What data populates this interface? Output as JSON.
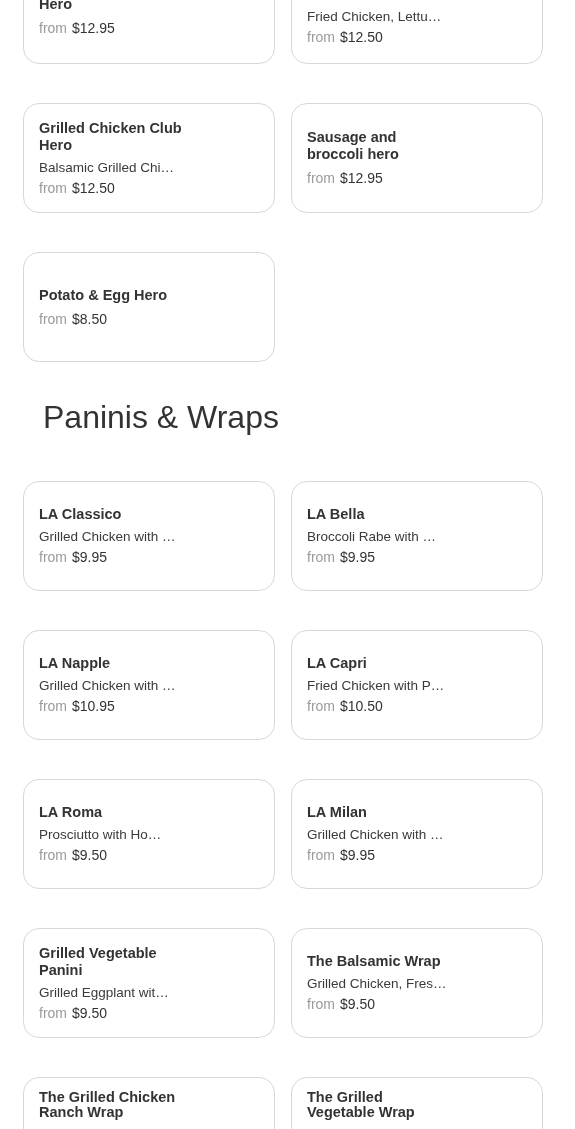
{
  "sections": [
    {
      "items": [
        {
          "name": "Hero",
          "price_prefix": "from",
          "price": "$12.95"
        },
        {
          "description": "Fried Chicken, Lettu…",
          "price_prefix": "from",
          "price": "$12.50"
        },
        {
          "name": "Grilled Chicken Club Hero",
          "description": "Balsamic Grilled Chi…",
          "price_prefix": "from",
          "price": "$12.50"
        },
        {
          "name": "Sausage and broccoli hero",
          "price_prefix": "from",
          "price": "$12.95"
        },
        {
          "name": "Potato & Egg Hero",
          "price_prefix": "from",
          "price": "$8.50"
        }
      ]
    },
    {
      "title": "Paninis & Wraps",
      "items": [
        {
          "name": "LA Classico",
          "description": "Grilled Chicken with …",
          "price_prefix": "from",
          "price": "$9.95"
        },
        {
          "name": "LA Bella",
          "description": "Broccoli Rabe with …",
          "price_prefix": "from",
          "price": "$9.95"
        },
        {
          "name": "LA Napple",
          "description": "Grilled Chicken with …",
          "price_prefix": "from",
          "price": "$10.95"
        },
        {
          "name": "LA Capri",
          "description": "Fried Chicken with P…",
          "price_prefix": "from",
          "price": "$10.50"
        },
        {
          "name": "LA Roma",
          "description": "Prosciutto with Ho…",
          "price_prefix": "from",
          "price": "$9.50"
        },
        {
          "name": "LA Milan",
          "description": "Grilled Chicken with …",
          "price_prefix": "from",
          "price": "$9.95"
        },
        {
          "name": "Grilled Vegetable Panini",
          "description": "Grilled Eggplant wit…",
          "price_prefix": "from",
          "price": "$9.50"
        },
        {
          "name": "The Balsamic Wrap",
          "description": "Grilled Chicken, Fres…",
          "price_prefix": "from",
          "price": "$9.50"
        },
        {
          "name": "The Grilled Chicken Ranch Wrap"
        },
        {
          "name": "The Grilled Vegetable Wrap"
        }
      ]
    }
  ]
}
